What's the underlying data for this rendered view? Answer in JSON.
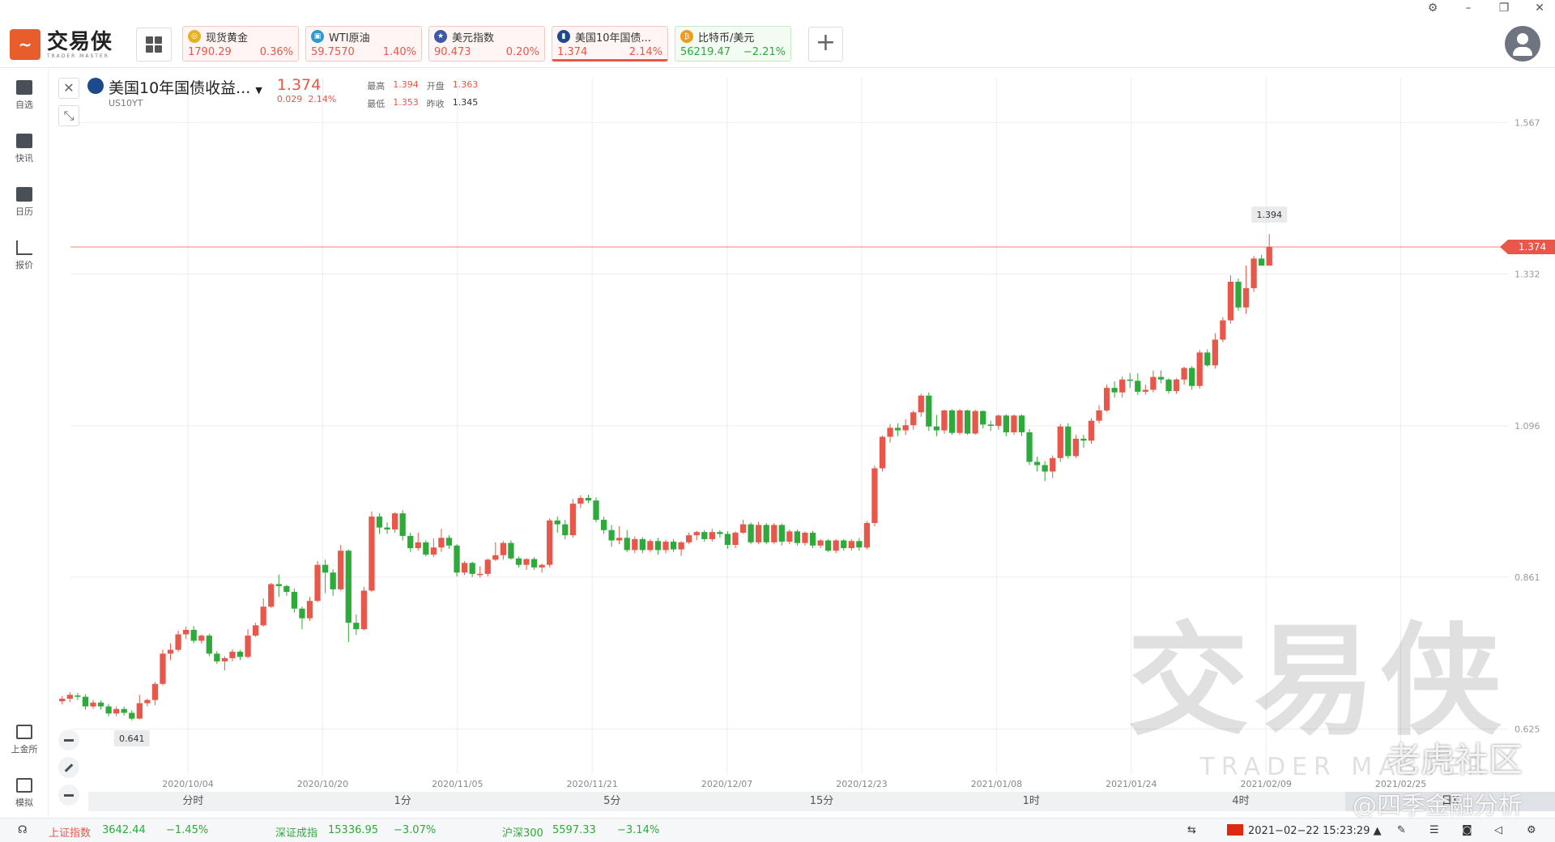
{
  "app": {
    "name_cn": "交易侠",
    "name_en": "TRADER MASTER"
  },
  "tabs": [
    {
      "name": "现货黄金",
      "price": "1790.29",
      "change": "0.36%",
      "dir": "up",
      "icon_color": "#e6b120",
      "icon": "coin-icon"
    },
    {
      "name": "WTI原油",
      "price": "59.7570",
      "change": "1.40%",
      "dir": "up",
      "icon_color": "#2c9ad1",
      "icon": "oil-icon"
    },
    {
      "name": "美元指数",
      "price": "90.473",
      "change": "0.20%",
      "dir": "up",
      "icon_color": "#3c5aa6",
      "icon": "us-flag-icon"
    },
    {
      "name": "美国10年国债...",
      "price": "1.374",
      "change": "2.14%",
      "dir": "up",
      "icon_color": "#1d4a8a",
      "icon": "bar-chart-icon"
    },
    {
      "name": "比特币/美元",
      "price": "56219.47",
      "change": "−2.21%",
      "dir": "down",
      "icon_color": "#f29a1a",
      "icon": "bitcoin-icon"
    }
  ],
  "sidebar": [
    {
      "label": "自选",
      "icon": "bookmark-icon"
    },
    {
      "label": "快讯",
      "icon": "news-icon"
    },
    {
      "label": "日历",
      "icon": "calendar-icon"
    },
    {
      "label": "报价",
      "icon": "chart-line-icon"
    }
  ],
  "sidebar_bottom": [
    {
      "label": "上金所",
      "icon": "exchange-icon"
    },
    {
      "label": "模拟",
      "icon": "wallet-icon"
    }
  ],
  "instrument": {
    "name": "美国10年国债收益...",
    "code": "US10YT",
    "price": "1.374",
    "change": "0.029",
    "change_pct": "2.14%",
    "high_label": "最高",
    "high": "1.394",
    "open_label": "开盘",
    "open": "1.363",
    "low_label": "最低",
    "low": "1.353",
    "prev_label": "昨收",
    "prev": "1.345"
  },
  "chart_data": {
    "type": "candlestick",
    "title": "",
    "xlabel": "",
    "ylabel": "",
    "y_ticks": [
      "1.567",
      "1.332",
      "1.096",
      "0.861",
      "0.625"
    ],
    "ylim": [
      0.555,
      1.637
    ],
    "x_ticks": [
      "2020/10/04",
      "2020/10/20",
      "2020/11/05",
      "2020/11/21",
      "2020/12/07",
      "2020/12/23",
      "2021/01/08",
      "2021/01/24",
      "2021/02/09",
      "2021/02/25"
    ],
    "current_price": "1.374",
    "max_label": "1.394",
    "min_label": "0.641",
    "series": [
      [
        0.668,
        0.672,
        0.663,
        0.676
      ],
      [
        0.672,
        0.678,
        0.667,
        0.682
      ],
      [
        0.677,
        0.675,
        0.67,
        0.681
      ],
      [
        0.675,
        0.66,
        0.655,
        0.679
      ],
      [
        0.66,
        0.666,
        0.656,
        0.67
      ],
      [
        0.666,
        0.66,
        0.655,
        0.669
      ],
      [
        0.66,
        0.649,
        0.645,
        0.664
      ],
      [
        0.649,
        0.656,
        0.645,
        0.66
      ],
      [
        0.656,
        0.65,
        0.646,
        0.66
      ],
      [
        0.65,
        0.641,
        0.638,
        0.654
      ],
      [
        0.641,
        0.665,
        0.64,
        0.678
      ],
      [
        0.665,
        0.67,
        0.66,
        0.672
      ],
      [
        0.67,
        0.695,
        0.662,
        0.698
      ],
      [
        0.695,
        0.742,
        0.693,
        0.748
      ],
      [
        0.742,
        0.748,
        0.732,
        0.758
      ],
      [
        0.748,
        0.772,
        0.745,
        0.778
      ],
      [
        0.772,
        0.779,
        0.765,
        0.784
      ],
      [
        0.779,
        0.762,
        0.758,
        0.785
      ],
      [
        0.762,
        0.77,
        0.758,
        0.772
      ],
      [
        0.77,
        0.742,
        0.738,
        0.773
      ],
      [
        0.742,
        0.73,
        0.726,
        0.746
      ],
      [
        0.73,
        0.735,
        0.716,
        0.738
      ],
      [
        0.735,
        0.745,
        0.73,
        0.749
      ],
      [
        0.745,
        0.737,
        0.732,
        0.748
      ],
      [
        0.737,
        0.77,
        0.735,
        0.78
      ],
      [
        0.77,
        0.786,
        0.768,
        0.79
      ],
      [
        0.786,
        0.815,
        0.784,
        0.828
      ],
      [
        0.815,
        0.85,
        0.813,
        0.852
      ],
      [
        0.85,
        0.847,
        0.83,
        0.865
      ],
      [
        0.847,
        0.838,
        0.832,
        0.849
      ],
      [
        0.838,
        0.812,
        0.806,
        0.843
      ],
      [
        0.812,
        0.797,
        0.78,
        0.815
      ],
      [
        0.797,
        0.824,
        0.793,
        0.83
      ],
      [
        0.824,
        0.88,
        0.822,
        0.886
      ],
      [
        0.88,
        0.868,
        0.836,
        0.888
      ],
      [
        0.868,
        0.842,
        0.832,
        0.873
      ],
      [
        0.842,
        0.902,
        0.84,
        0.911
      ],
      [
        0.902,
        0.79,
        0.76,
        0.904
      ],
      [
        0.79,
        0.78,
        0.771,
        0.803
      ],
      [
        0.78,
        0.84,
        0.778,
        0.846
      ],
      [
        0.84,
        0.955,
        0.838,
        0.963
      ],
      [
        0.955,
        0.938,
        0.928,
        0.96
      ],
      [
        0.938,
        0.935,
        0.928,
        0.946
      ],
      [
        0.935,
        0.96,
        0.93,
        0.962
      ],
      [
        0.96,
        0.925,
        0.918,
        0.965
      ],
      [
        0.925,
        0.906,
        0.9,
        0.93
      ],
      [
        0.906,
        0.915,
        0.902,
        0.93
      ],
      [
        0.915,
        0.896,
        0.893,
        0.918
      ],
      [
        0.896,
        0.907,
        0.892,
        0.921
      ],
      [
        0.907,
        0.922,
        0.9,
        0.936
      ],
      [
        0.922,
        0.91,
        0.905,
        0.926
      ],
      [
        0.91,
        0.868,
        0.862,
        0.912
      ],
      [
        0.868,
        0.883,
        0.864,
        0.886
      ],
      [
        0.883,
        0.866,
        0.861,
        0.885
      ],
      [
        0.866,
        0.866,
        0.86,
        0.878
      ],
      [
        0.866,
        0.888,
        0.862,
        0.89
      ],
      [
        0.888,
        0.895,
        0.886,
        0.915
      ],
      [
        0.895,
        0.914,
        0.888,
        0.917
      ],
      [
        0.914,
        0.89,
        0.888,
        0.918
      ],
      [
        0.89,
        0.88,
        0.876,
        0.893
      ],
      [
        0.88,
        0.889,
        0.872,
        0.89
      ],
      [
        0.889,
        0.876,
        0.872,
        0.892
      ],
      [
        0.876,
        0.88,
        0.868,
        0.882
      ],
      [
        0.88,
        0.949,
        0.876,
        0.952
      ],
      [
        0.949,
        0.943,
        0.93,
        0.955
      ],
      [
        0.943,
        0.926,
        0.92,
        0.95
      ],
      [
        0.926,
        0.975,
        0.922,
        0.982
      ],
      [
        0.975,
        0.984,
        0.968,
        0.988
      ],
      [
        0.984,
        0.98,
        0.976,
        0.989
      ],
      [
        0.98,
        0.95,
        0.946,
        0.985
      ],
      [
        0.95,
        0.934,
        0.928,
        0.955
      ],
      [
        0.934,
        0.918,
        0.908,
        0.942
      ],
      [
        0.918,
        0.922,
        0.912,
        0.94
      ],
      [
        0.922,
        0.903,
        0.9,
        0.934
      ],
      [
        0.903,
        0.92,
        0.898,
        0.924
      ],
      [
        0.92,
        0.903,
        0.898,
        0.923
      ],
      [
        0.903,
        0.917,
        0.9,
        0.92
      ],
      [
        0.917,
        0.903,
        0.896,
        0.922
      ],
      [
        0.903,
        0.916,
        0.898,
        0.919
      ],
      [
        0.916,
        0.904,
        0.9,
        0.92
      ],
      [
        0.904,
        0.915,
        0.894,
        0.917
      ],
      [
        0.915,
        0.926,
        0.912,
        0.93
      ],
      [
        0.926,
        0.931,
        0.918,
        0.933
      ],
      [
        0.931,
        0.92,
        0.916,
        0.934
      ],
      [
        0.92,
        0.931,
        0.916,
        0.936
      ],
      [
        0.931,
        0.928,
        0.922,
        0.934
      ],
      [
        0.928,
        0.911,
        0.905,
        0.932
      ],
      [
        0.911,
        0.93,
        0.906,
        0.932
      ],
      [
        0.93,
        0.943,
        0.928,
        0.95
      ],
      [
        0.943,
        0.915,
        0.912,
        0.946
      ],
      [
        0.915,
        0.942,
        0.912,
        0.947
      ],
      [
        0.942,
        0.915,
        0.912,
        0.945
      ],
      [
        0.915,
        0.942,
        0.912,
        0.945
      ],
      [
        0.942,
        0.916,
        0.91,
        0.944
      ],
      [
        0.916,
        0.932,
        0.912,
        0.935
      ],
      [
        0.932,
        0.914,
        0.91,
        0.935
      ],
      [
        0.914,
        0.93,
        0.91,
        0.932
      ],
      [
        0.93,
        0.91,
        0.906,
        0.933
      ],
      [
        0.91,
        0.918,
        0.906,
        0.92
      ],
      [
        0.918,
        0.902,
        0.9,
        0.92
      ],
      [
        0.902,
        0.918,
        0.898,
        0.92
      ],
      [
        0.918,
        0.906,
        0.902,
        0.92
      ],
      [
        0.906,
        0.917,
        0.902,
        0.92
      ],
      [
        0.917,
        0.907,
        0.902,
        0.922
      ],
      [
        0.907,
        0.945,
        0.904,
        0.948
      ],
      [
        0.945,
        1.03,
        0.94,
        1.034
      ],
      [
        1.03,
        1.079,
        1.025,
        1.081
      ],
      [
        1.079,
        1.093,
        1.07,
        1.099
      ],
      [
        1.093,
        1.089,
        1.08,
        1.1
      ],
      [
        1.089,
        1.097,
        1.082,
        1.106
      ],
      [
        1.097,
        1.117,
        1.09,
        1.12
      ],
      [
        1.117,
        1.143,
        1.11,
        1.146
      ],
      [
        1.143,
        1.095,
        1.088,
        1.148
      ],
      [
        1.095,
        1.089,
        1.08,
        1.113
      ],
      [
        1.089,
        1.12,
        1.084,
        1.121
      ],
      [
        1.12,
        1.085,
        1.082,
        1.122
      ],
      [
        1.085,
        1.12,
        1.082,
        1.122
      ],
      [
        1.12,
        1.084,
        1.082,
        1.121
      ],
      [
        1.084,
        1.119,
        1.082,
        1.121
      ],
      [
        1.119,
        1.098,
        1.092,
        1.12
      ],
      [
        1.098,
        1.096,
        1.088,
        1.104
      ],
      [
        1.096,
        1.112,
        1.09,
        1.114
      ],
      [
        1.112,
        1.086,
        1.08,
        1.114
      ],
      [
        1.086,
        1.112,
        1.082,
        1.114
      ],
      [
        1.112,
        1.086,
        1.08,
        1.114
      ],
      [
        1.086,
        1.04,
        1.035,
        1.091
      ],
      [
        1.04,
        1.035,
        1.025,
        1.048
      ],
      [
        1.035,
        1.025,
        1.01,
        1.041
      ],
      [
        1.025,
        1.046,
        1.015,
        1.05
      ],
      [
        1.046,
        1.095,
        1.04,
        1.099
      ],
      [
        1.095,
        1.049,
        1.045,
        1.1
      ],
      [
        1.049,
        1.076,
        1.046,
        1.082
      ],
      [
        1.076,
        1.073,
        1.062,
        1.082
      ],
      [
        1.073,
        1.104,
        1.068,
        1.108
      ],
      [
        1.104,
        1.12,
        1.1,
        1.128
      ],
      [
        1.12,
        1.155,
        1.118,
        1.16
      ],
      [
        1.155,
        1.148,
        1.14,
        1.165
      ],
      [
        1.148,
        1.168,
        1.14,
        1.173
      ],
      [
        1.168,
        1.166,
        1.155,
        1.178
      ],
      [
        1.166,
        1.149,
        1.144,
        1.178
      ],
      [
        1.149,
        1.152,
        1.145,
        1.16
      ],
      [
        1.152,
        1.172,
        1.148,
        1.182
      ],
      [
        1.172,
        1.168,
        1.162,
        1.182
      ],
      [
        1.168,
        1.15,
        1.146,
        1.17
      ],
      [
        1.15,
        1.168,
        1.146,
        1.17
      ],
      [
        1.168,
        1.186,
        1.16,
        1.188
      ],
      [
        1.186,
        1.158,
        1.152,
        1.189
      ],
      [
        1.158,
        1.21,
        1.154,
        1.214
      ],
      [
        1.21,
        1.19,
        1.188,
        1.215
      ],
      [
        1.19,
        1.23,
        1.185,
        1.24
      ],
      [
        1.23,
        1.26,
        1.226,
        1.265
      ],
      [
        1.26,
        1.32,
        1.255,
        1.33
      ],
      [
        1.32,
        1.28,
        1.275,
        1.325
      ],
      [
        1.28,
        1.31,
        1.27,
        1.345
      ],
      [
        1.31,
        1.356,
        1.304,
        1.36
      ],
      [
        1.356,
        1.345,
        1.35,
        1.362
      ],
      [
        1.345,
        1.374,
        1.353,
        1.394
      ]
    ]
  },
  "periods": [
    "分时",
    "1分",
    "5分",
    "15分",
    "1时",
    "4时",
    "日K"
  ],
  "active_period": "日K",
  "status": {
    "idx1_name": "上证指数",
    "idx1_val": "3642.44",
    "idx1_chg": "−1.45%",
    "idx2_name": "深证成指",
    "idx2_val": "15336.95",
    "idx2_chg": "−3.07%",
    "idx3_name": "沪深300",
    "idx3_val": "5597.33",
    "idx3_chg": "−3.14%",
    "datetime": "2021−02−22 15:23:29"
  },
  "watermark": {
    "cn": "交易侠",
    "en": "TRADER MASTER",
    "tiger": "老虎社区",
    "author": "@四季金融分析"
  },
  "colors": {
    "up": "#e8574a",
    "down": "#2daa3a",
    "grid": "#ebedf0",
    "accent": "#e85d2c"
  }
}
